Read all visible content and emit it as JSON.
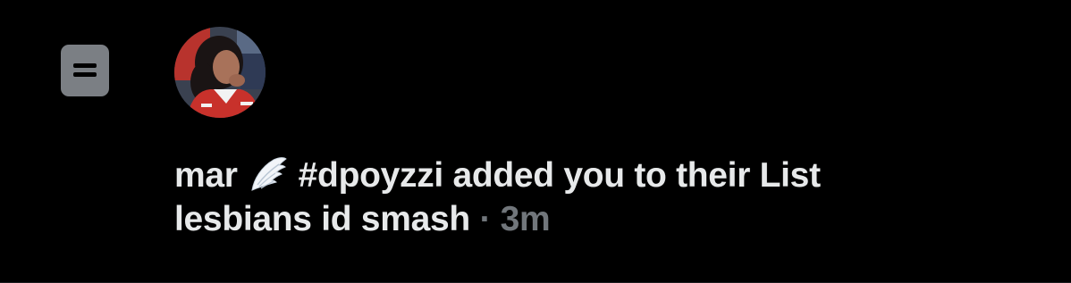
{
  "notification": {
    "type_icon": "list-icon",
    "avatar_icon": "avatar-photo",
    "user_name": "mar",
    "name_emoji": "wing-emoji",
    "action_text": "#dpoyzzi added you to their List",
    "list_name": "lesbians id smash",
    "separator": "·",
    "timestamp": "3m"
  },
  "colors": {
    "background": "#000000",
    "text": "#e7e9ea",
    "secondary_text": "#71767b",
    "list_icon_bg": "#7b7f84"
  }
}
